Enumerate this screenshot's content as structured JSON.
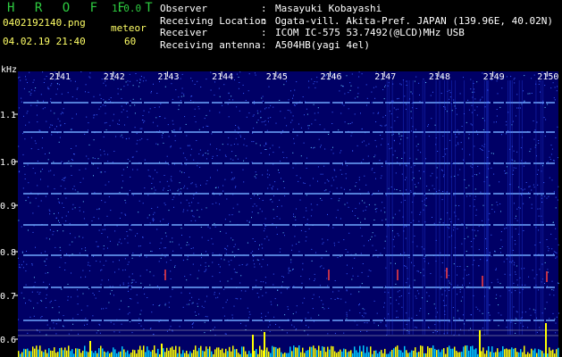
{
  "header": {
    "app_title": "H R O F F T",
    "app_version": "1.0.0",
    "filename": "0402192140.png",
    "mode_label": "meteor",
    "timestamp": "04.02.19 21:40",
    "count": "60"
  },
  "meta": [
    {
      "key": "Observer",
      "value": "Masayuki Kobayashi"
    },
    {
      "key": "Receiving Location",
      "value": "Ogata-vill. Akita-Pref. JAPAN (139.96E, 40.02N)"
    },
    {
      "key": "Receiver",
      "value": "ICOM IC-575 53.7492(@LCD)MHz USB"
    },
    {
      "key": "Receiving antenna",
      "value": "A504HB(yagi 4el)"
    }
  ],
  "chart_data": {
    "type": "heatmap",
    "ylabel": "kHz",
    "x_ticks": [
      "2141",
      "2142",
      "2143",
      "2144",
      "2145",
      "2146",
      "2147",
      "2148",
      "2149",
      "2150"
    ],
    "y_ticks": [
      "1.1",
      "1.0",
      "0.9",
      "0.8",
      "0.7",
      "0.6"
    ],
    "colors": {
      "background": "#000066",
      "hline": "#6fa8ff",
      "noise": "#3a5fff",
      "hot": "#ff4040",
      "baseline": "#ffff00"
    }
  }
}
